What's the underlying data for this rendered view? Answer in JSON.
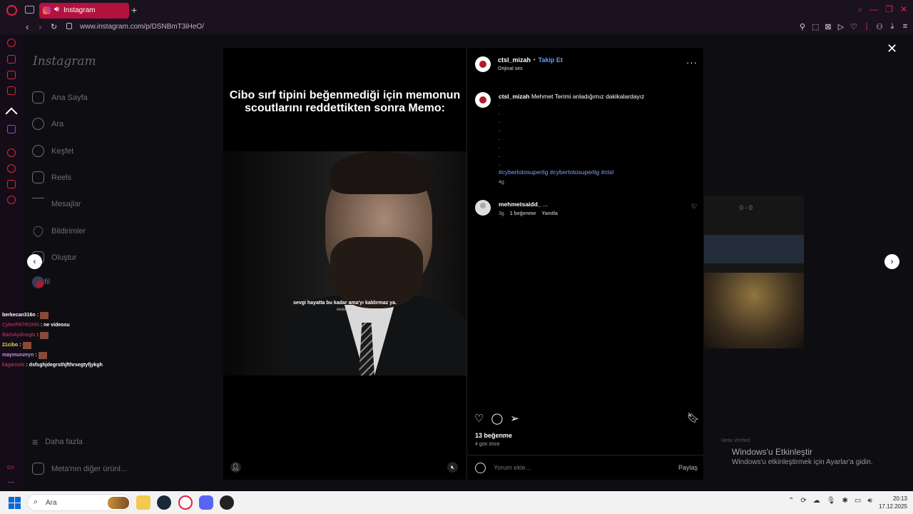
{
  "browser": {
    "tab_title": "Instagram",
    "url": "www.instagram.com/p/DSNBmT3iHeO/"
  },
  "instagram_nav": {
    "logo": "Instagram",
    "items": [
      {
        "label": "Ana Sayfa",
        "icon": "home-icon"
      },
      {
        "label": "Ara",
        "icon": "search-icon"
      },
      {
        "label": "Keşfet",
        "icon": "compass-icon"
      },
      {
        "label": "Reels",
        "icon": "reels-icon"
      },
      {
        "label": "Mesajlar",
        "icon": "messenger-icon"
      },
      {
        "label": "Bildirimler",
        "icon": "heart-icon"
      },
      {
        "label": "Oluştur",
        "icon": "plus-icon"
      },
      {
        "label": "Profil",
        "icon": "avatar-icon"
      }
    ],
    "more": "Daha fazla",
    "meta_apps": "Meta'nın diğer ürünl..."
  },
  "chat_overlay": [
    {
      "user": "berkecan316n",
      "text": ":",
      "color": "#ffffff"
    },
    {
      "user": "CyberPATRONN",
      "text": ": ne videosu",
      "color": "#e0335a"
    },
    {
      "user": "BarisAydinoglu",
      "text": ":",
      "color": "#e0335a"
    },
    {
      "user": "21cibo",
      "text": ":",
      "color": "#f0d25a"
    },
    {
      "user": "maymunzeyn",
      "text": ":",
      "color": "#c98cf0"
    },
    {
      "user": "kaganseki",
      "text": ": dsfsghjdegrsthjfthrsegtyfjykgh",
      "color": "#e0335a"
    }
  ],
  "media": {
    "caption": "Cibo sırf tipini beğenmediği için memonun scoutlarını reddettikten sonra Memo:",
    "subtitle": "sevgi hayatta bu kadar ama'yı kaldırmaz ya.",
    "subtitle_credit": "tekilstoper"
  },
  "post": {
    "username": "ctsl_mizah",
    "separator": "•",
    "follow_label": "Takip Et",
    "audio": "Orijinal ses",
    "caption_user": "ctsl_mizah",
    "caption_text": "Mehmet Terimi anladığımız dakikalardayız",
    "caption_dots": [
      ".",
      ".",
      ".",
      ".",
      ".",
      ".",
      ".",
      "."
    ],
    "hashtags": "#cybertotosuperlig #cybertotosuperlig #ctsl",
    "caption_age": "4g",
    "comment": {
      "username": "mehmetsaidd_",
      "text": "...",
      "age": "3g",
      "likes": "1 beğenme",
      "reply": "Yanıtla"
    },
    "like_count": "13 beğenme",
    "posted": "4 gün önce",
    "comment_placeholder": "Yorum ekle...",
    "share": "Paylaş"
  },
  "background": {
    "score": "0 - 0",
    "watermark_title": "Windows'u Etkinleştir",
    "watermark_sub": "Windows'u etkinleştirmek için Ayarlar'a gidin.",
    "meta_verified": "Meta Verified"
  },
  "taskbar": {
    "search_placeholder": "Ara",
    "time": "20:13",
    "date": "17.12.2025"
  },
  "colors": {
    "opera_red": "#e0233e",
    "link_blue": "#5aa2f5",
    "hashtag": "#8e9df5"
  }
}
